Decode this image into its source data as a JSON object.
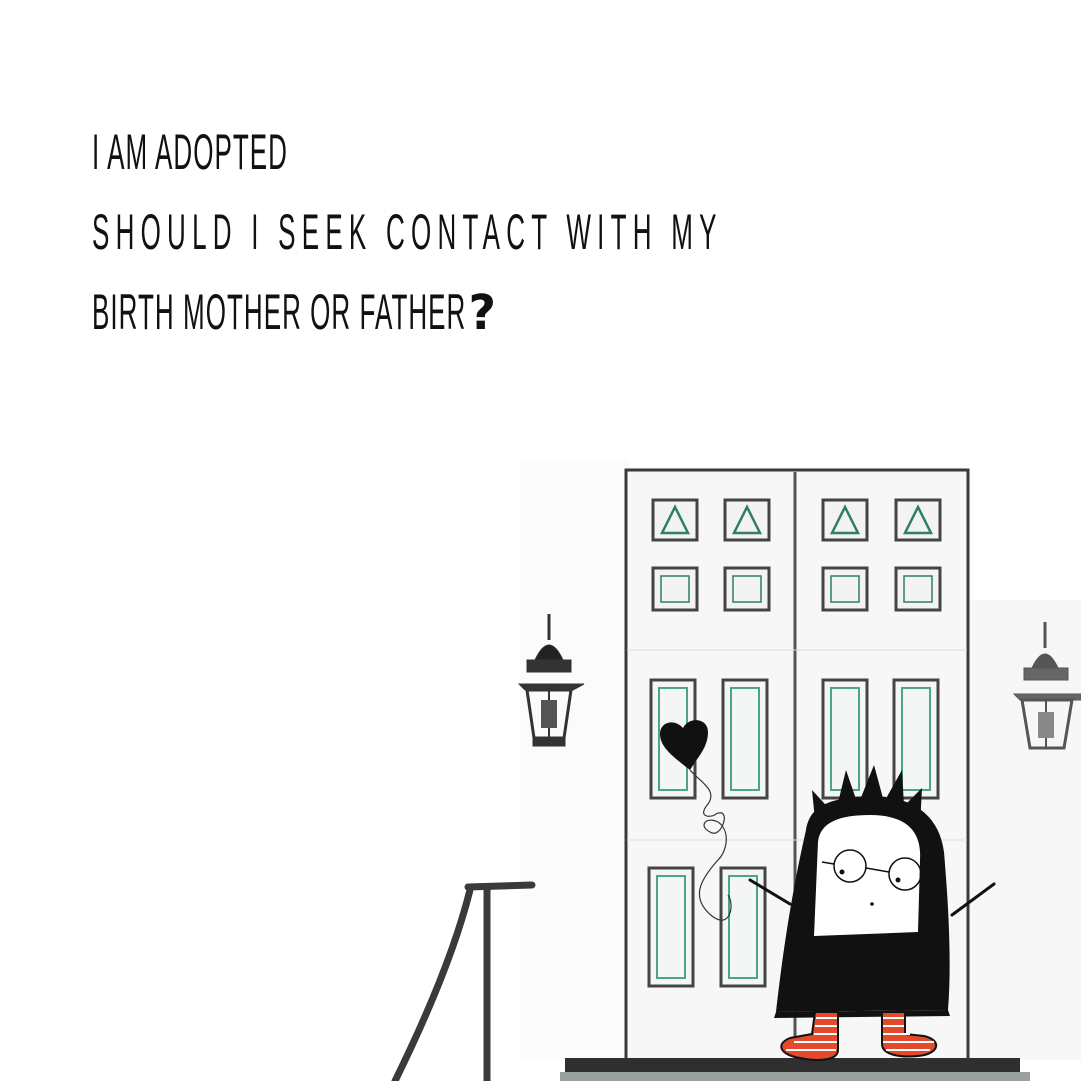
{
  "headline": {
    "line1": "I am adopted",
    "line2": "should I seek contact with my",
    "line3": "birth mother or father",
    "punctuation": "?"
  },
  "colors": {
    "ink": "#111111",
    "door": "#f6f7f6",
    "door_outline": "#3a3a3a",
    "panel_accent": "#4aa58c",
    "sock_red": "#e24a2b"
  },
  "icons": [
    "heart-balloon-icon",
    "wall-lantern-icon",
    "handrail-icon",
    "character-illustration"
  ]
}
